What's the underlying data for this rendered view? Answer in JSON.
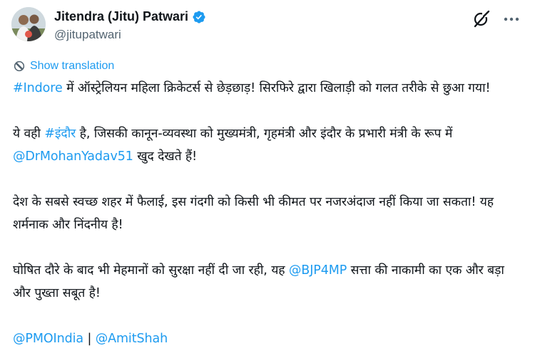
{
  "author": {
    "name": "Jitendra (Jitu) Patwari",
    "handle": "@jitupatwari"
  },
  "header": {
    "grok_icon": "grok-icon",
    "more_icon": "more-options-icon"
  },
  "show_translation": "Show translation",
  "post": {
    "p1": {
      "tag": "#Indore",
      "text": " में ऑस्ट्रेलियन महिला क्रिकेटर्स से छेड़छाड़! सिरफिरे द्वारा खिलाड़ी को गलत तरीके से छुआ गया!"
    },
    "p2": {
      "pre": "ये वही ",
      "tag": "#इंदौर",
      "mid": " है, जिसकी कानून-व्यवस्था को मुख्यमंत्री, गृहमंत्री और इंदौर के प्रभारी मंत्री के रूप में ",
      "mention": "@DrMohanYadav51",
      "post": " खुद देखते हैं!"
    },
    "p3": "देश के सबसे स्वच्छ शहर में फैलाई, इस गंदगी को किसी भी कीमत पर नजरअंदाज नहीं किया जा सकता! यह शर्मनाक और निंदनीय है!",
    "p4": {
      "pre": "घोषित दौरे के बाद भी मेहमानों को सुरक्षा नहीं दी जा रही, यह ",
      "mention": "@BJP4MP",
      "post": " सत्ता की नाकामी का एक और बड़ा और पुख्ता सबूत है!"
    },
    "p5": {
      "mention1": "@PMOIndia",
      "sep": " | ",
      "mention2": "@AmitShah"
    }
  },
  "colors": {
    "link": "#1d9bf0",
    "text": "#0f1419",
    "secondary": "#536471",
    "verified": "#1d9bf0"
  }
}
